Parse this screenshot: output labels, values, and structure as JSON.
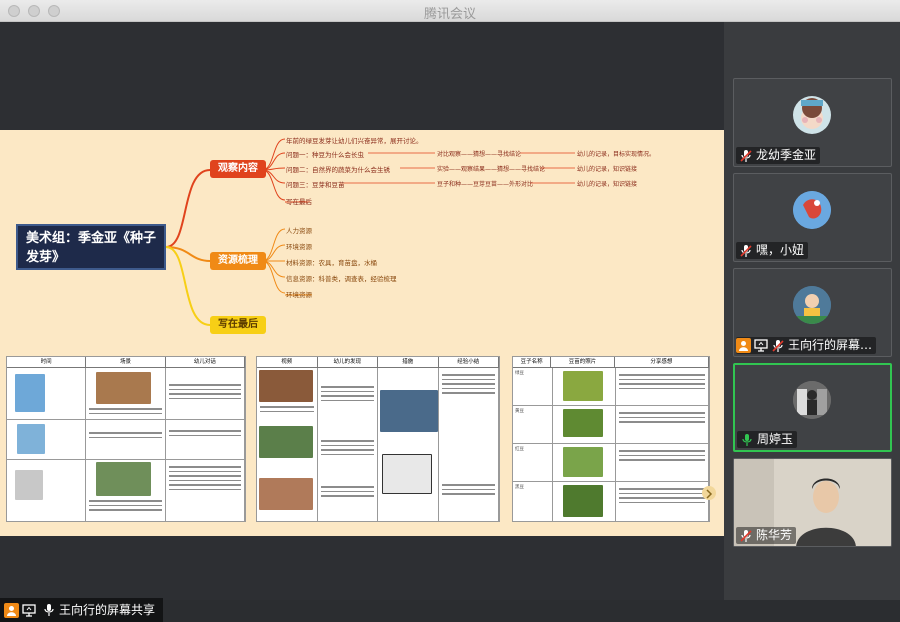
{
  "window": {
    "title": "腾讯会议"
  },
  "slide": {
    "central_topic": "美术组：季金亚《种子发芽》",
    "branches": [
      {
        "label": "观察内容",
        "color": "#e0431d"
      },
      {
        "label": "资源梳理",
        "color": "#f08a16"
      },
      {
        "label": "写在最后",
        "color": "#f7cf16"
      }
    ],
    "observe_items": [
      "年前的绿豆发芽让幼儿们兴奋异常，展开讨论。",
      "问题一：种豆为什么会长虫",
      "问题二：自然界的蔬菜为什么会生锈",
      "问题三：豆芽和豆苗",
      "写在最后"
    ],
    "observe_steps": [
      "对比观察——猜想——寻找结论",
      "实验——观察结果——猜想——寻找结论",
      "豆子和种——豆芽豆苗——外形对比"
    ],
    "observe_results": [
      "幼儿的记录，目标实现情况。",
      "幼儿的记录，知识链接",
      "幼儿的记录，知识链接"
    ],
    "resource_items": [
      "人力资源",
      "环境资源",
      "材料资源：农具，育苗盘，水桶",
      "信息资源：科普类，调查表，经验梳理",
      "环境资源"
    ],
    "table1_headers": [
      "时间",
      "场景",
      "幼儿对话"
    ],
    "table2_headers": [
      "视频",
      "幼儿的发现",
      "措施",
      "经验小结"
    ],
    "table3_headers": [
      "豆子名称",
      "豆苗的照片",
      "分享感想"
    ],
    "table3_rows": [
      "绿豆",
      "黄豆",
      "红豆",
      "黑豆"
    ]
  },
  "participants": [
    {
      "name": "龙幼季金亚",
      "mic": "muted",
      "avatar_color": "#cfe3e8",
      "accent": "#e7b3b8"
    },
    {
      "name": "嘿，小妞",
      "mic": "muted",
      "avatar_color": "#6aa8e0",
      "accent": "#d9473a"
    },
    {
      "name": "王向行的屏幕…",
      "mic": "muted",
      "avatar_color": "#4f7a9a",
      "accent": "#f5c242",
      "sharing": true
    },
    {
      "name": "周婷玉",
      "mic": "active",
      "avatar_color": "#6b6b6b",
      "accent": "#dcdcdc"
    },
    {
      "name": "陈华芳",
      "mic": "muted",
      "avatar_color": "#d9d3c8",
      "accent": "#3c3c3c"
    }
  ],
  "share_label": "王向行的屏幕共享",
  "colors": {
    "active_border": "#31c551",
    "share_badge": "#f08a16"
  }
}
